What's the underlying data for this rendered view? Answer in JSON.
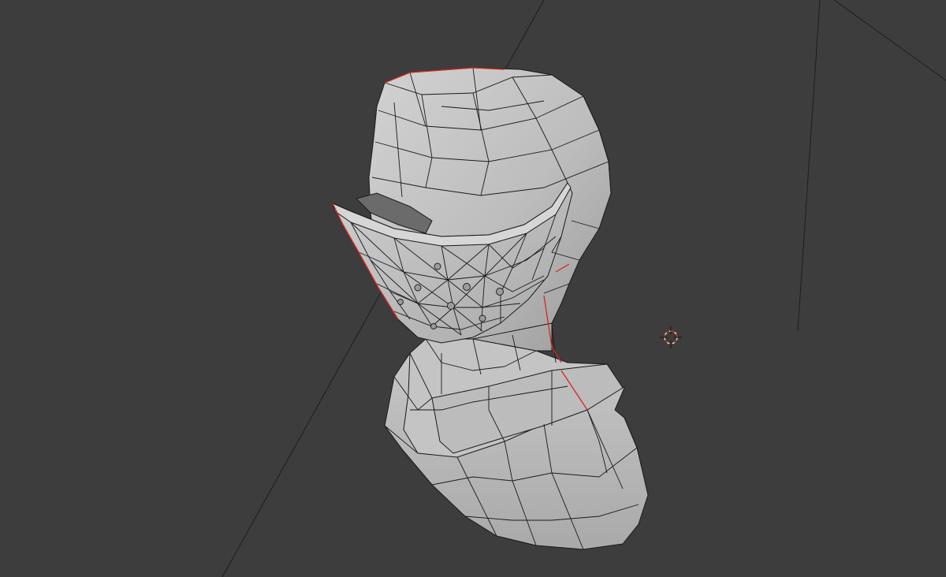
{
  "viewport": {
    "background_color": "#3d3d3d",
    "grid_line_color": "#1e1e1e",
    "mesh_fill_color": "#b9b9b9",
    "wire_color": "#1a1a1a",
    "seam_color": "#d8261e",
    "cursor_color": "#e6e6e6"
  },
  "scene": {
    "object": "helmet-bust-mesh",
    "mode": "wireframe-overlay",
    "icons": [
      "3d-cursor-icon"
    ]
  }
}
